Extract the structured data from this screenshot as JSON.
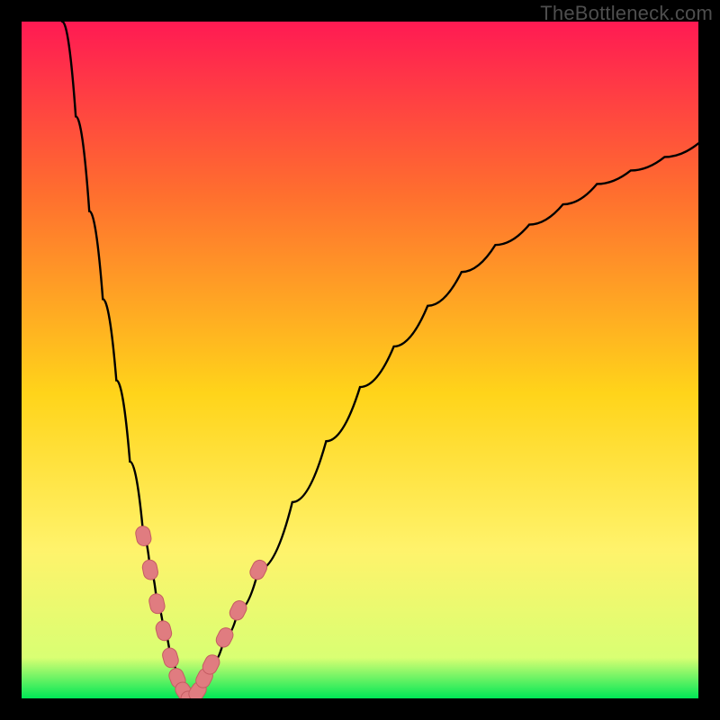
{
  "watermark": "TheBottleneck.com",
  "colors": {
    "gradient_stops": [
      {
        "offset": 0.0,
        "color": "#ff1a53"
      },
      {
        "offset": 0.25,
        "color": "#ff6d2f"
      },
      {
        "offset": 0.55,
        "color": "#ffd41a"
      },
      {
        "offset": 0.78,
        "color": "#fff36b"
      },
      {
        "offset": 0.94,
        "color": "#d9ff73"
      },
      {
        "offset": 1.0,
        "color": "#00e756"
      }
    ],
    "curve": "#000000",
    "marker_fill": "#e07c80",
    "marker_stroke": "#c55c62"
  },
  "chart_data": {
    "type": "line",
    "title": "",
    "xlabel": "",
    "ylabel": "",
    "xlim": [
      0,
      100
    ],
    "ylim": [
      0,
      100
    ],
    "grid": false,
    "legend": false,
    "annotations": [
      "TheBottleneck.com"
    ],
    "series": [
      {
        "name": "left-branch",
        "x": [
          6,
          8,
          10,
          12,
          14,
          16,
          18,
          19,
          20,
          21,
          22,
          23,
          24,
          25
        ],
        "values": [
          100,
          86,
          72,
          59,
          47,
          35,
          24,
          19,
          14,
          10,
          6,
          3,
          1,
          0
        ]
      },
      {
        "name": "right-branch",
        "x": [
          25,
          26,
          27,
          28,
          30,
          32,
          35,
          40,
          45,
          50,
          55,
          60,
          65,
          70,
          75,
          80,
          85,
          90,
          95,
          100
        ],
        "values": [
          0,
          1,
          3,
          5,
          9,
          13,
          19,
          29,
          38,
          46,
          52,
          58,
          63,
          67,
          70,
          73,
          76,
          78,
          80,
          82
        ]
      }
    ],
    "markers": {
      "name": "highlighted-points",
      "style": "pill",
      "points": [
        {
          "x": 18,
          "y": 24
        },
        {
          "x": 19,
          "y": 19
        },
        {
          "x": 20,
          "y": 14
        },
        {
          "x": 21,
          "y": 10
        },
        {
          "x": 22,
          "y": 6
        },
        {
          "x": 23,
          "y": 3
        },
        {
          "x": 24,
          "y": 1
        },
        {
          "x": 25,
          "y": 0
        },
        {
          "x": 26,
          "y": 1
        },
        {
          "x": 27,
          "y": 3
        },
        {
          "x": 28,
          "y": 5
        },
        {
          "x": 30,
          "y": 9
        },
        {
          "x": 32,
          "y": 13
        },
        {
          "x": 35,
          "y": 19
        }
      ]
    }
  }
}
